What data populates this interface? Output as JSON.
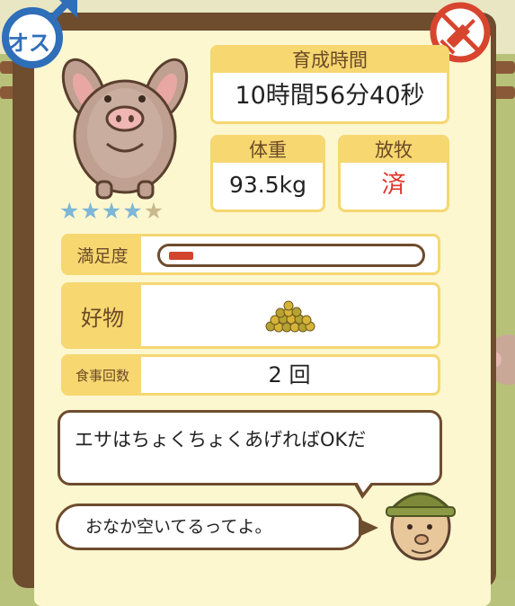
{
  "header": {
    "gender_label": "オス",
    "gender_icon": "male-symbol-icon",
    "vaccine_icon": "syringe-icon"
  },
  "pig": {
    "portrait_icon": "pig-face-icon",
    "stars_filled": 4,
    "stars_total": 5
  },
  "stats": {
    "time_label": "育成時間",
    "time_value": "10時間56分40秒",
    "weight_label": "体重",
    "weight_value": "93.5kg",
    "grazing_label": "放牧",
    "grazing_value": "済"
  },
  "satisfaction": {
    "label": "満足度",
    "level": 0.1
  },
  "favorite": {
    "label": "好物",
    "item_icon": "feed-pellets-icon"
  },
  "meals": {
    "label": "食事回数",
    "value": "2 回"
  },
  "dialog": {
    "hint": "エサはちょくちょくあげればOKだ",
    "status": "おなか空いてるってよ。",
    "speaker_icon": "farmer-face-icon"
  },
  "colors": {
    "frame": "#6e4c2e",
    "panel": "#fdf7d0",
    "label_bg": "#f6d770",
    "gender": "#2f6eb8",
    "vaccine": "#d8452f",
    "grazing_done": "#e0352a",
    "star_on": "#7db6d6"
  }
}
